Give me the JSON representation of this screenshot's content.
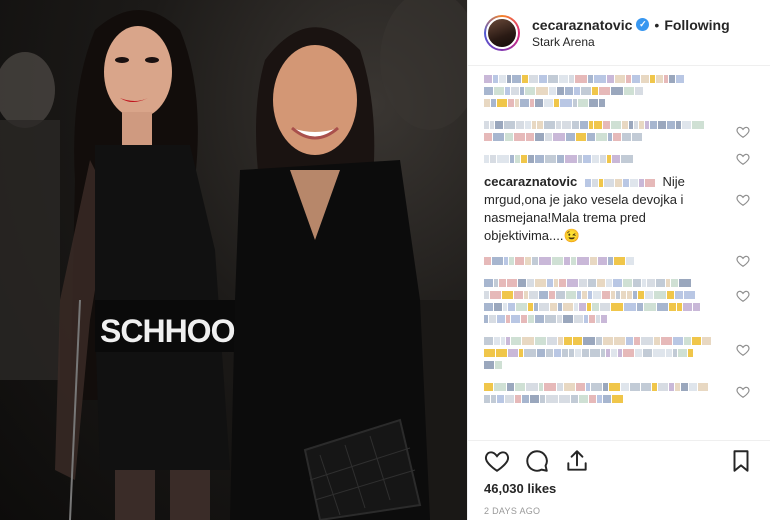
{
  "post": {
    "username": "cecaraznatovic",
    "separator": "•",
    "follow_status": "Following",
    "location": "Stark Arena",
    "verified_glyph": "✓",
    "photo_text": "SCHHOOSO"
  },
  "comments": {
    "highlighted": {
      "username": "cecaraznatovic",
      "text": "Nije mrgud,ona je jako vesela devojka i nasmejana!Mala trema pred objektivima....😉"
    }
  },
  "footer": {
    "likes": "46,030 likes",
    "time_ago": "2 DAYS AGO"
  },
  "colors": {
    "verified_blue": "#3897f0",
    "border": "#efefef",
    "text": "#262626",
    "muted": "#999999"
  }
}
